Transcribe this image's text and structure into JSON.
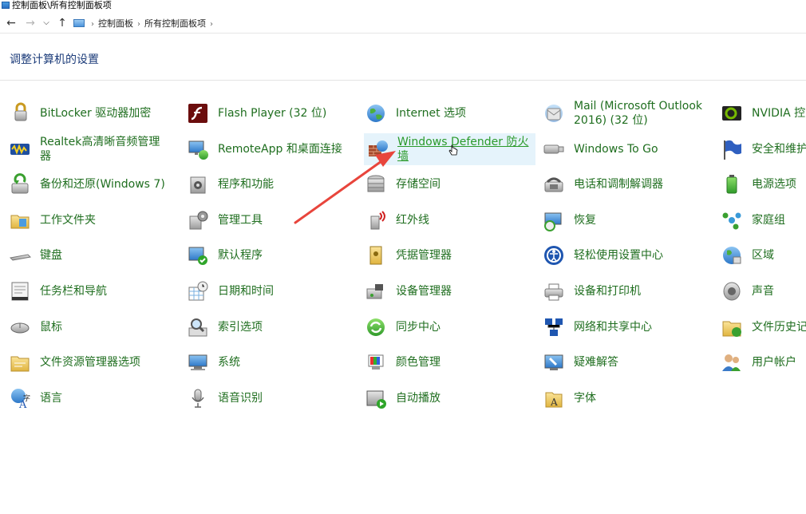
{
  "window": {
    "title": "控制面板\\所有控制面板项"
  },
  "breadcrumb": [
    "控制面板",
    "所有控制面板项"
  ],
  "header": {
    "title": "调整计算机的设置"
  },
  "colors": {
    "link": "#1f6e1f",
    "title": "#1c3c7a",
    "highlight": "#e5f3fb",
    "arrow": "#e8453c"
  },
  "items": [
    {
      "label": "BitLocker 驱动器加密",
      "icon": "lock-icon"
    },
    {
      "label": "Flash Player (32 位)",
      "icon": "flash-icon"
    },
    {
      "label": "Internet 选项",
      "icon": "globe-icon"
    },
    {
      "label": "Mail (Microsoft Outlook 2016) (32 位)",
      "icon": "mail-icon"
    },
    {
      "label": "NVIDIA 控",
      "icon": "nvidia-icon"
    },
    {
      "label": "Realtek高清晰音频管理器",
      "icon": "audio-wave-icon"
    },
    {
      "label": "RemoteApp 和桌面连接",
      "icon": "remote-desktop-icon"
    },
    {
      "label": "Windows Defender 防火墙",
      "icon": "firewall-icon"
    },
    {
      "label": "Windows To Go",
      "icon": "usb-drive-icon"
    },
    {
      "label": "安全和维护",
      "icon": "flag-icon"
    },
    {
      "label": "备份和还原(Windows 7)",
      "icon": "backup-icon"
    },
    {
      "label": "程序和功能",
      "icon": "programs-icon"
    },
    {
      "label": "存储空间",
      "icon": "storage-icon"
    },
    {
      "label": "电话和调制解调器",
      "icon": "phone-icon"
    },
    {
      "label": "电源选项",
      "icon": "power-icon"
    },
    {
      "label": "工作文件夹",
      "icon": "folder-icon"
    },
    {
      "label": "管理工具",
      "icon": "tools-icon"
    },
    {
      "label": "红外线",
      "icon": "infrared-icon"
    },
    {
      "label": "恢复",
      "icon": "recovery-icon"
    },
    {
      "label": "家庭组",
      "icon": "homegroup-icon"
    },
    {
      "label": "键盘",
      "icon": "keyboard-icon"
    },
    {
      "label": "默认程序",
      "icon": "default-programs-icon"
    },
    {
      "label": "凭据管理器",
      "icon": "credential-icon"
    },
    {
      "label": "轻松使用设置中心",
      "icon": "ease-of-access-icon"
    },
    {
      "label": "区域",
      "icon": "region-icon"
    },
    {
      "label": "任务栏和导航",
      "icon": "taskbar-icon"
    },
    {
      "label": "日期和时间",
      "icon": "calendar-clock-icon"
    },
    {
      "label": "设备管理器",
      "icon": "device-manager-icon"
    },
    {
      "label": "设备和打印机",
      "icon": "printer-icon"
    },
    {
      "label": "声音",
      "icon": "speaker-icon"
    },
    {
      "label": "鼠标",
      "icon": "mouse-icon"
    },
    {
      "label": "索引选项",
      "icon": "search-index-icon"
    },
    {
      "label": "同步中心",
      "icon": "sync-icon"
    },
    {
      "label": "网络和共享中心",
      "icon": "network-icon"
    },
    {
      "label": "文件历史记",
      "icon": "file-history-icon"
    },
    {
      "label": "文件资源管理器选项",
      "icon": "folder-options-icon"
    },
    {
      "label": "系统",
      "icon": "system-icon"
    },
    {
      "label": "颜色管理",
      "icon": "color-management-icon"
    },
    {
      "label": "疑难解答",
      "icon": "troubleshoot-icon"
    },
    {
      "label": "用户帐户",
      "icon": "user-accounts-icon"
    },
    {
      "label": "语言",
      "icon": "language-icon"
    },
    {
      "label": "语音识别",
      "icon": "microphone-icon"
    },
    {
      "label": "自动播放",
      "icon": "autoplay-icon"
    },
    {
      "label": "字体",
      "icon": "fonts-icon"
    }
  ]
}
